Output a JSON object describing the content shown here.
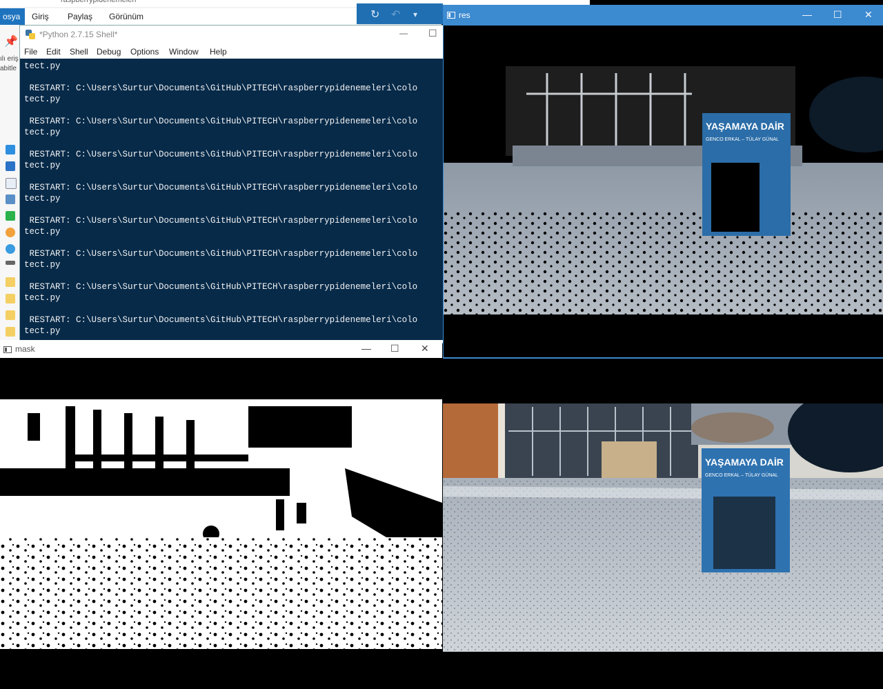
{
  "explorer": {
    "title": "raspberrypidenemeleri",
    "tabs": [
      "osya",
      "Giriş",
      "Paylaş",
      "Görünüm"
    ],
    "side_labels": [
      "ılı eriş",
      "abitle"
    ]
  },
  "shell": {
    "title": "*Python 2.7.15 Shell*",
    "menu": [
      "File",
      "Edit",
      "Shell",
      "Debug",
      "Options",
      "Window",
      "Help"
    ],
    "first_line": "tect.py",
    "restart_line": " RESTART: C:\\Users\\Surtur\\Documents\\GitHub\\PITECH\\raspberrypidenemeleri\\colo",
    "wrap_line": "tect.py"
  },
  "windows": {
    "res_title": "res",
    "mask_title": "mask"
  },
  "icons": {
    "refresh": "↻",
    "undo": "↶",
    "dropdown": "▾",
    "minimize": "—",
    "maximize": "☐",
    "close": "✕"
  },
  "book": {
    "title": "YAŞAMAYA DAİR",
    "authors": "GENCO ERKAL – TÜLAY GÜNAL"
  },
  "colors": {
    "console_bg": "#072a49",
    "active_title": "#3c8ad0",
    "accent_blue": "#1f6fb2"
  }
}
